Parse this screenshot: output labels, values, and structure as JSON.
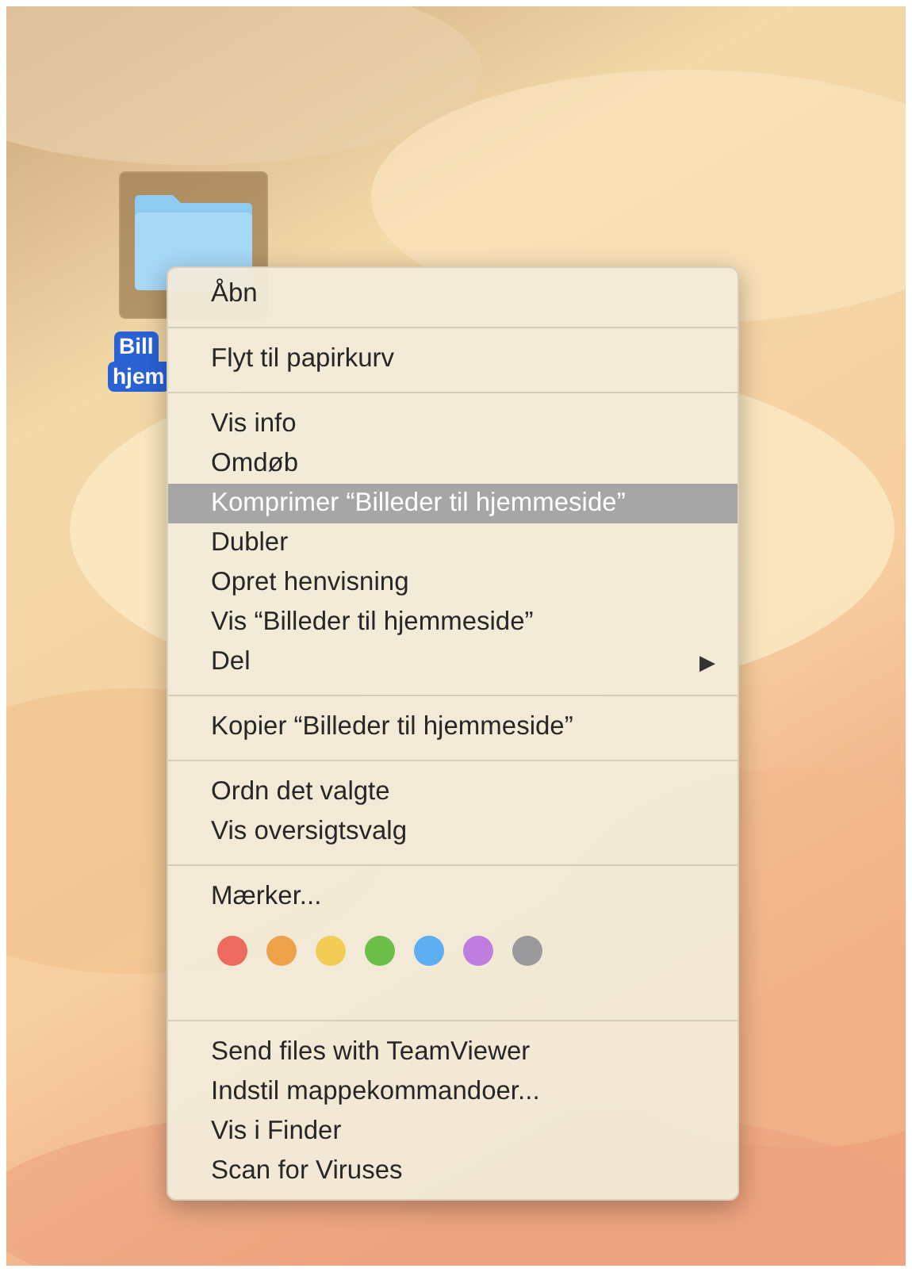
{
  "desktop": {
    "folder": {
      "label_lines": [
        "Bill",
        "hjem"
      ],
      "selected": true
    }
  },
  "context_menu": {
    "sections": [
      {
        "kind": "items",
        "items": [
          {
            "label": "Åbn",
            "selected": false,
            "submenu": false
          }
        ]
      },
      {
        "kind": "items",
        "items": [
          {
            "label": "Flyt til papirkurv",
            "selected": false,
            "submenu": false
          }
        ]
      },
      {
        "kind": "items",
        "items": [
          {
            "label": "Vis info",
            "selected": false,
            "submenu": false
          },
          {
            "label": "Omdøb",
            "selected": false,
            "submenu": false
          },
          {
            "label": "Komprimer “Billeder til hjemmeside”",
            "selected": true,
            "submenu": false
          },
          {
            "label": "Dubler",
            "selected": false,
            "submenu": false
          },
          {
            "label": "Opret henvisning",
            "selected": false,
            "submenu": false
          },
          {
            "label": "Vis “Billeder til hjemmeside”",
            "selected": false,
            "submenu": false
          },
          {
            "label": "Del",
            "selected": false,
            "submenu": true,
            "arrow": "▶"
          }
        ]
      },
      {
        "kind": "items",
        "items": [
          {
            "label": "Kopier “Billeder til hjemmeside”",
            "selected": false,
            "submenu": false
          }
        ]
      },
      {
        "kind": "items",
        "items": [
          {
            "label": "Ordn det valgte",
            "selected": false,
            "submenu": false
          },
          {
            "label": "Vis oversigtsvalg",
            "selected": false,
            "submenu": false
          }
        ]
      },
      {
        "kind": "tags",
        "label": "Mærker...",
        "tags": [
          {
            "color": "#ec6a5e"
          },
          {
            "color": "#eda24a"
          },
          {
            "color": "#f2cc55"
          },
          {
            "color": "#6cc04a"
          },
          {
            "color": "#5eaef2"
          },
          {
            "color": "#bf7de0"
          },
          {
            "color": "#9a9a9c"
          }
        ]
      },
      {
        "kind": "items",
        "items": [
          {
            "label": "Send files with TeamViewer",
            "selected": false,
            "submenu": false
          },
          {
            "label": "Indstil mappekommandoer...",
            "selected": false,
            "submenu": false
          },
          {
            "label": "Vis i Finder",
            "selected": false,
            "submenu": false
          },
          {
            "label": "Scan for Viruses",
            "selected": false,
            "submenu": false
          }
        ]
      }
    ]
  }
}
